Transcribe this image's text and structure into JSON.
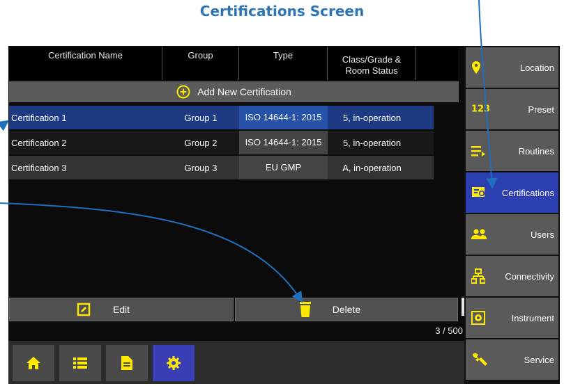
{
  "page_title": "Certifications Screen",
  "table": {
    "headers": {
      "name": "Certification Name",
      "group": "Group",
      "type": "Type",
      "class_line1": "Class/Grade &",
      "class_line2": "Room Status"
    },
    "add_label": "Add New Certification",
    "rows": [
      {
        "name": "Certification 1",
        "group": "Group 1",
        "type": "ISO 14644-1: 2015",
        "class": "5, in-operation"
      },
      {
        "name": "Certification 2",
        "group": "Group 2",
        "type": "ISO 14644-1: 2015",
        "class": "5, in-operation"
      },
      {
        "name": "Certification 3",
        "group": "Group 3",
        "type": "EU GMP",
        "class": "A, in-operation"
      }
    ]
  },
  "actions": {
    "edit": "Edit",
    "delete": "Delete"
  },
  "count": "3 / 500",
  "bottom_tabs": [
    "home-icon",
    "list-icon",
    "document-icon",
    "gear-icon"
  ],
  "sidebar": {
    "items": [
      {
        "label": "Location",
        "icon": "location-pin-icon"
      },
      {
        "label": "Preset",
        "icon": "123",
        "icon_name": "numbers-icon"
      },
      {
        "label": "Routines",
        "icon": "routines-icon"
      },
      {
        "label": "Certifications",
        "icon": "certificate-icon"
      },
      {
        "label": "Users",
        "icon": "users-icon"
      },
      {
        "label": "Connectivity",
        "icon": "network-icon"
      },
      {
        "label": "Instrument",
        "icon": "instrument-icon"
      },
      {
        "label": "Service",
        "icon": "wrench-icon"
      }
    ]
  },
  "colors": {
    "accent_yellow": "#ffe900",
    "active_blue": "#2b3fb0",
    "title_blue": "#2e75b6"
  }
}
